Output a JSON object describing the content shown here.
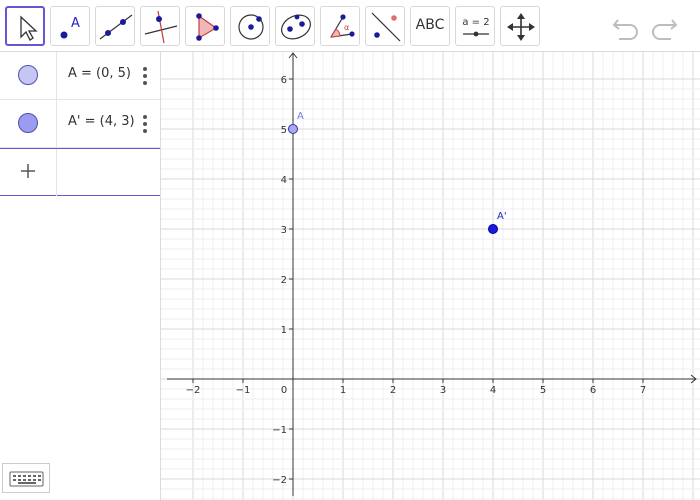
{
  "toolbar": {
    "tools": [
      {
        "name": "move",
        "icon": "move-arrow-icon",
        "active": true
      },
      {
        "name": "point",
        "icon": "point-icon",
        "icon_letter": "A"
      },
      {
        "name": "line",
        "icon": "line-through-two-points-icon"
      },
      {
        "name": "perpendicular",
        "icon": "perpendicular-line-icon"
      },
      {
        "name": "polygon",
        "icon": "polygon-icon"
      },
      {
        "name": "circle",
        "icon": "circle-center-point-icon"
      },
      {
        "name": "ellipse",
        "icon": "ellipse-icon"
      },
      {
        "name": "angle",
        "icon": "angle-icon",
        "icon_letter": "α"
      },
      {
        "name": "reflect",
        "icon": "reflect-about-line-icon"
      },
      {
        "name": "text",
        "label": "ABC"
      },
      {
        "name": "slider",
        "label": "a = 2",
        "icon": "slider-icon"
      },
      {
        "name": "move-graphics",
        "icon": "move-graphics-view-icon"
      }
    ],
    "undo_icon": "undo-icon",
    "redo_icon": "redo-icon"
  },
  "algebra": {
    "rows": [
      {
        "name": "A",
        "text": "A = (0, 5)",
        "color": "#c6c6f5"
      },
      {
        "name": "A'",
        "text": "A' = (4, 3)",
        "color": "#9b9bef"
      }
    ],
    "input_icon": "plus-icon"
  },
  "keyboard": {
    "icon": "keyboard-icon"
  },
  "graphics": {
    "x_ticks": [
      "−2",
      "−1",
      "0",
      "1",
      "2",
      "3",
      "4",
      "5",
      "6",
      "7"
    ],
    "y_ticks": [
      "6",
      "5",
      "4",
      "3",
      "2",
      "1",
      "−1",
      "−2"
    ],
    "points": [
      {
        "label": "A",
        "x": 0,
        "y": 5,
        "fill": "#a9a9f0",
        "stroke": "#3333aa",
        "label_color": "#7a7ae0"
      },
      {
        "label": "A'",
        "x": 4,
        "y": 3,
        "fill": "#1a1adb",
        "stroke": "#0000aa",
        "label_color": "#2222cc"
      }
    ],
    "colors": {
      "axis": "#333333",
      "grid": "#d9d9d9",
      "accent": "#6557d2"
    }
  }
}
